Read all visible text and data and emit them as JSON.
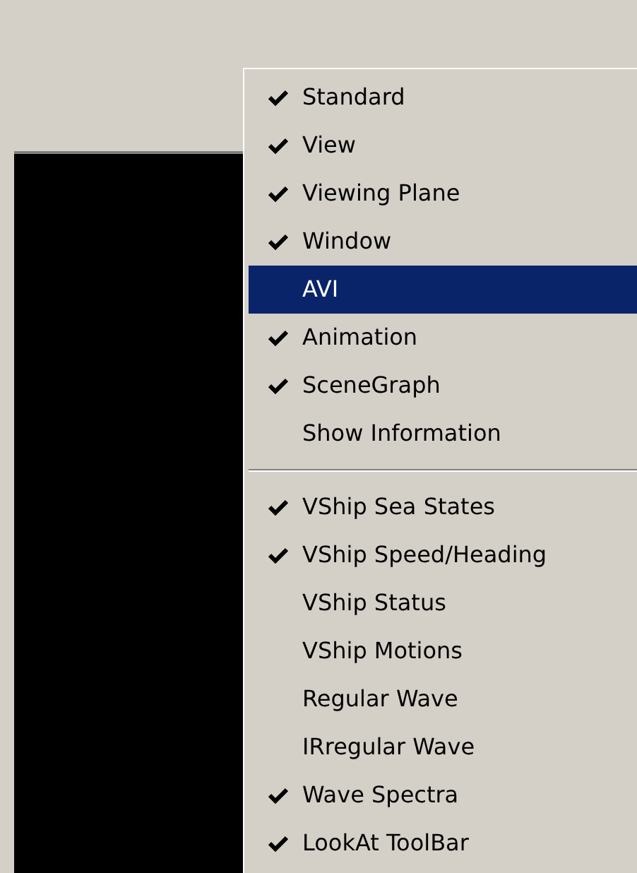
{
  "menu": {
    "groups": [
      [
        {
          "label": "Standard",
          "checked": true,
          "selected": false
        },
        {
          "label": "View",
          "checked": true,
          "selected": false
        },
        {
          "label": "Viewing Plane",
          "checked": true,
          "selected": false
        },
        {
          "label": "Window",
          "checked": true,
          "selected": false
        },
        {
          "label": "AVI",
          "checked": false,
          "selected": true
        },
        {
          "label": "Animation",
          "checked": true,
          "selected": false
        },
        {
          "label": "SceneGraph",
          "checked": true,
          "selected": false
        },
        {
          "label": "Show Information",
          "checked": false,
          "selected": false
        }
      ],
      [
        {
          "label": "VShip Sea States",
          "checked": true,
          "selected": false
        },
        {
          "label": "VShip Speed/Heading",
          "checked": true,
          "selected": false
        },
        {
          "label": "VShip Status",
          "checked": false,
          "selected": false
        },
        {
          "label": "VShip Motions",
          "checked": false,
          "selected": false
        },
        {
          "label": "Regular Wave",
          "checked": false,
          "selected": false
        },
        {
          "label": "IRregular Wave",
          "checked": false,
          "selected": false
        },
        {
          "label": "Wave Spectra",
          "checked": true,
          "selected": false
        },
        {
          "label": "LookAt ToolBar",
          "checked": true,
          "selected": false
        }
      ]
    ]
  }
}
